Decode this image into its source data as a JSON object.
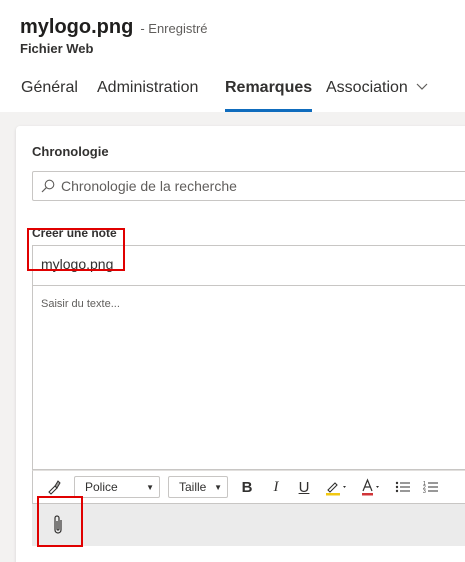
{
  "record": {
    "title": "mylogo.png",
    "status": "- Enregistré",
    "entity": "Fichier Web"
  },
  "tabs": [
    {
      "label": "Général",
      "active": false
    },
    {
      "label": "Administration",
      "active": false
    },
    {
      "label": "Remarques",
      "active": true
    },
    {
      "label": "Association",
      "active": false,
      "has_dropdown": true
    }
  ],
  "timeline": {
    "title": "Chronologie",
    "search_placeholder": "Chronologie de la recherche",
    "search_icon": "search-icon"
  },
  "note": {
    "label": "Créer une note",
    "title_value": "mylogo.png",
    "body_placeholder": "Saisir du texte..."
  },
  "toolbar": {
    "font_label": "Police",
    "size_label": "Taille",
    "bold": "B",
    "italic": "I",
    "underline": "U",
    "font_color": "A",
    "icons": [
      "format-painter-icon",
      "highlight-icon",
      "font-color-icon",
      "bullet-list-icon",
      "numbered-list-icon"
    ]
  },
  "attachment": {
    "icon": "paperclip-icon"
  },
  "colors": {
    "accent": "#0f6cbd",
    "highlight_box": "#e00000",
    "canvas": "#f3f2f1",
    "attach_bar": "#ebebeb"
  }
}
